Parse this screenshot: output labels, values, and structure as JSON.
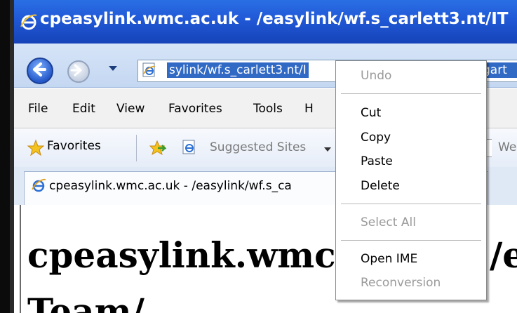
{
  "window": {
    "title": "cpeasylink.wmc.ac.uk - /easylink/wf.s_carlett3.nt/IT"
  },
  "address_bar": {
    "url_left": "sylink/wf.s_carlett3.nt/I",
    "url_right": "gart"
  },
  "menu_bar": {
    "items": [
      "File",
      "Edit",
      "View",
      "Favorites",
      "Tools",
      "H"
    ]
  },
  "favorites_bar": {
    "favorites_label": "Favorites",
    "suggested_sites_label": "Suggested Sites",
    "right_label": "We"
  },
  "tab": {
    "label": "cpeasylink.wmc.ac.uk - /easylink/wf.s_ca"
  },
  "page": {
    "heading_line1_left": "cpeasylink.wmc",
    "heading_line1_right": "/e",
    "heading_line2": "Team/"
  },
  "context_menu": {
    "items": [
      {
        "label": "Undo",
        "enabled": false
      },
      {
        "label": "Cut",
        "enabled": true
      },
      {
        "label": "Copy",
        "enabled": true
      },
      {
        "label": "Paste",
        "enabled": true
      },
      {
        "label": "Delete",
        "enabled": true
      },
      {
        "label": "Select All",
        "enabled": false
      },
      {
        "label": "Open IME",
        "enabled": true
      },
      {
        "label": "Reconversion",
        "enabled": false
      }
    ]
  },
  "icons": {
    "title": "ie-logo-icon",
    "back": "back-arrow-icon",
    "forward": "forward-arrow-icon",
    "address": "ie-page-icon",
    "favorites": "star-icon",
    "add_favorite": "add-favorite-icon",
    "tab": "ie-logo-icon"
  },
  "colors": {
    "titlebar": "#2058d6",
    "selection": "#316ac5",
    "disabled_text": "#9a9a9a"
  }
}
